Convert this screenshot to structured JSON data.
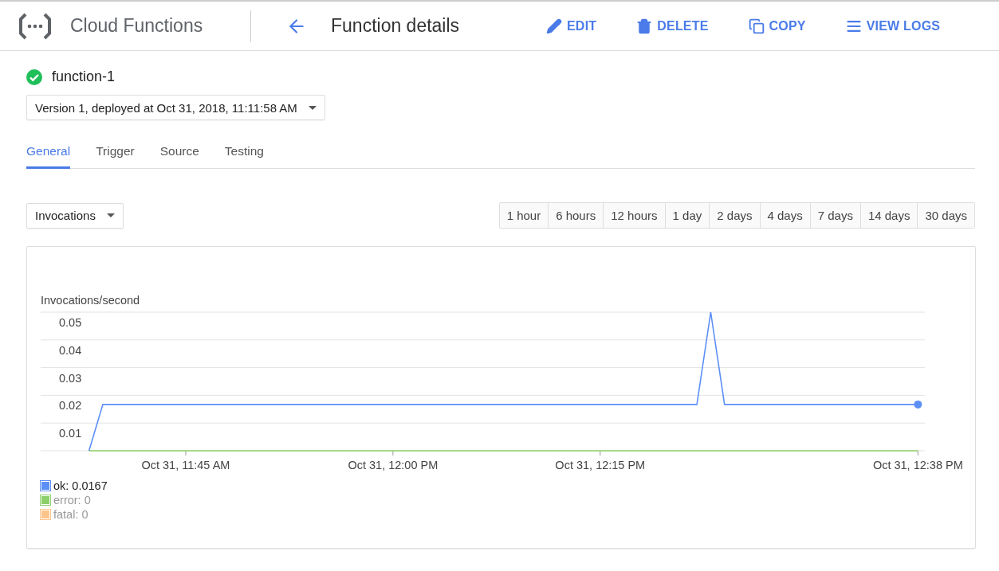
{
  "header": {
    "product": "Cloud Functions",
    "page_title": "Function details",
    "actions": [
      {
        "kind": "edit",
        "label": "EDIT"
      },
      {
        "kind": "delete",
        "label": "DELETE"
      },
      {
        "kind": "copy",
        "label": "COPY"
      },
      {
        "kind": "logs",
        "label": "VIEW LOGS"
      }
    ]
  },
  "function": {
    "name": "function-1",
    "version": "Version 1, deployed at Oct 31, 2018, 11:11:58 AM"
  },
  "tabs": [
    {
      "label": "General",
      "selected": true
    },
    {
      "label": "Trigger",
      "selected": false
    },
    {
      "label": "Source",
      "selected": false
    },
    {
      "label": "Testing",
      "selected": false
    }
  ],
  "metric": {
    "value": "Invocations"
  },
  "ranges": [
    {
      "label": "1 hour",
      "selected": false
    },
    {
      "label": "6 hours",
      "selected": false
    },
    {
      "label": "12 hours",
      "selected": false
    },
    {
      "label": "1 day",
      "selected": false
    },
    {
      "label": "2 days",
      "selected": false
    },
    {
      "label": "4 days",
      "selected": false
    },
    {
      "label": "7 days",
      "selected": false
    },
    {
      "label": "14 days",
      "selected": false
    },
    {
      "label": "30 days",
      "selected": false
    }
  ],
  "chart_data": {
    "type": "line",
    "ylabel": "Invocations/second",
    "categories": [
      null,
      null,
      null,
      null,
      null,
      null,
      null,
      null,
      null,
      null,
      "Oct 31, 11:45 AM",
      null,
      null,
      null,
      null,
      null,
      null,
      null,
      null,
      null,
      null,
      null,
      null,
      null,
      null,
      "Oct 31, 12:00 PM",
      null,
      null,
      null,
      null,
      null,
      null,
      null,
      null,
      null,
      null,
      null,
      null,
      null,
      null,
      "Oct 31, 12:15 PM",
      null,
      null,
      null,
      null,
      null,
      null,
      null,
      null,
      null,
      null,
      null,
      null,
      null,
      null,
      null,
      null,
      null,
      null,
      null,
      null,
      null,
      null,
      "Oct 31, 12:38 PM"
    ],
    "series": [
      {
        "name": "ok: 0.0167",
        "color": "#5c8ff6",
        "values": [
          null,
          null,
          null,
          0,
          0.0167,
          0.0167,
          0.0167,
          0.0167,
          0.0167,
          0.0167,
          0.0167,
          0.0167,
          0.0167,
          0.0167,
          0.0167,
          0.0167,
          0.0167,
          0.0167,
          0.0167,
          0.0167,
          0.0167,
          0.0167,
          0.0167,
          0.0167,
          0.0167,
          0.0167,
          0.0167,
          0.0167,
          0.0167,
          0.0167,
          0.0167,
          0.0167,
          0.0167,
          0.0167,
          0.0167,
          0.0167,
          0.0167,
          0.0167,
          0.0167,
          0.0167,
          0.0167,
          0.0167,
          0.0167,
          0.0167,
          0.0167,
          0.0167,
          0.0167,
          0.0167,
          0.05,
          0.0167,
          0.0167,
          0.0167,
          0.0167,
          0.0167,
          0.0167,
          0.0167,
          0.0167,
          0.0167,
          0.0167,
          0.0167,
          0.0167,
          0.0167,
          0.0167,
          0.0167
        ]
      },
      {
        "name": "error: 0",
        "color": "#8dcf6a",
        "values": [
          null,
          null,
          null,
          0,
          0,
          0,
          0,
          0,
          0,
          0,
          0,
          0,
          0,
          0,
          0,
          0,
          0,
          0,
          0,
          0,
          0,
          0,
          0,
          0,
          0,
          0,
          0,
          0,
          0,
          0,
          0,
          0,
          0,
          0,
          0,
          0,
          0,
          0,
          0,
          0,
          0,
          0,
          0,
          0,
          0,
          0,
          0,
          0,
          0,
          0,
          0,
          0,
          0,
          0,
          0,
          0,
          0,
          0,
          0,
          0,
          0,
          0,
          0,
          0
        ]
      },
      {
        "name": "fatal: 0",
        "color": "#fdc58b",
        "values": [
          null,
          null,
          null,
          null,
          null,
          null,
          null,
          null,
          null,
          null,
          null,
          null,
          null,
          null,
          null,
          null,
          null,
          null,
          null,
          null,
          null,
          null,
          null,
          null,
          null,
          null,
          null,
          null,
          null,
          null,
          null,
          null,
          null,
          null,
          null,
          null,
          null,
          null,
          null,
          null,
          null,
          null,
          null,
          null,
          null,
          null,
          null,
          null,
          null,
          null,
          null,
          null,
          null,
          null,
          null,
          null,
          null,
          null,
          null,
          null,
          null,
          null,
          null,
          null
        ]
      }
    ],
    "ylim": [
      0,
      0.05
    ],
    "grid": true,
    "yticks": [
      0.01,
      0.02,
      0.03,
      0.04,
      0.05
    ]
  },
  "legend": [
    {
      "dimmed": false
    },
    {
      "dimmed": true
    },
    {
      "dimmed": true
    }
  ]
}
